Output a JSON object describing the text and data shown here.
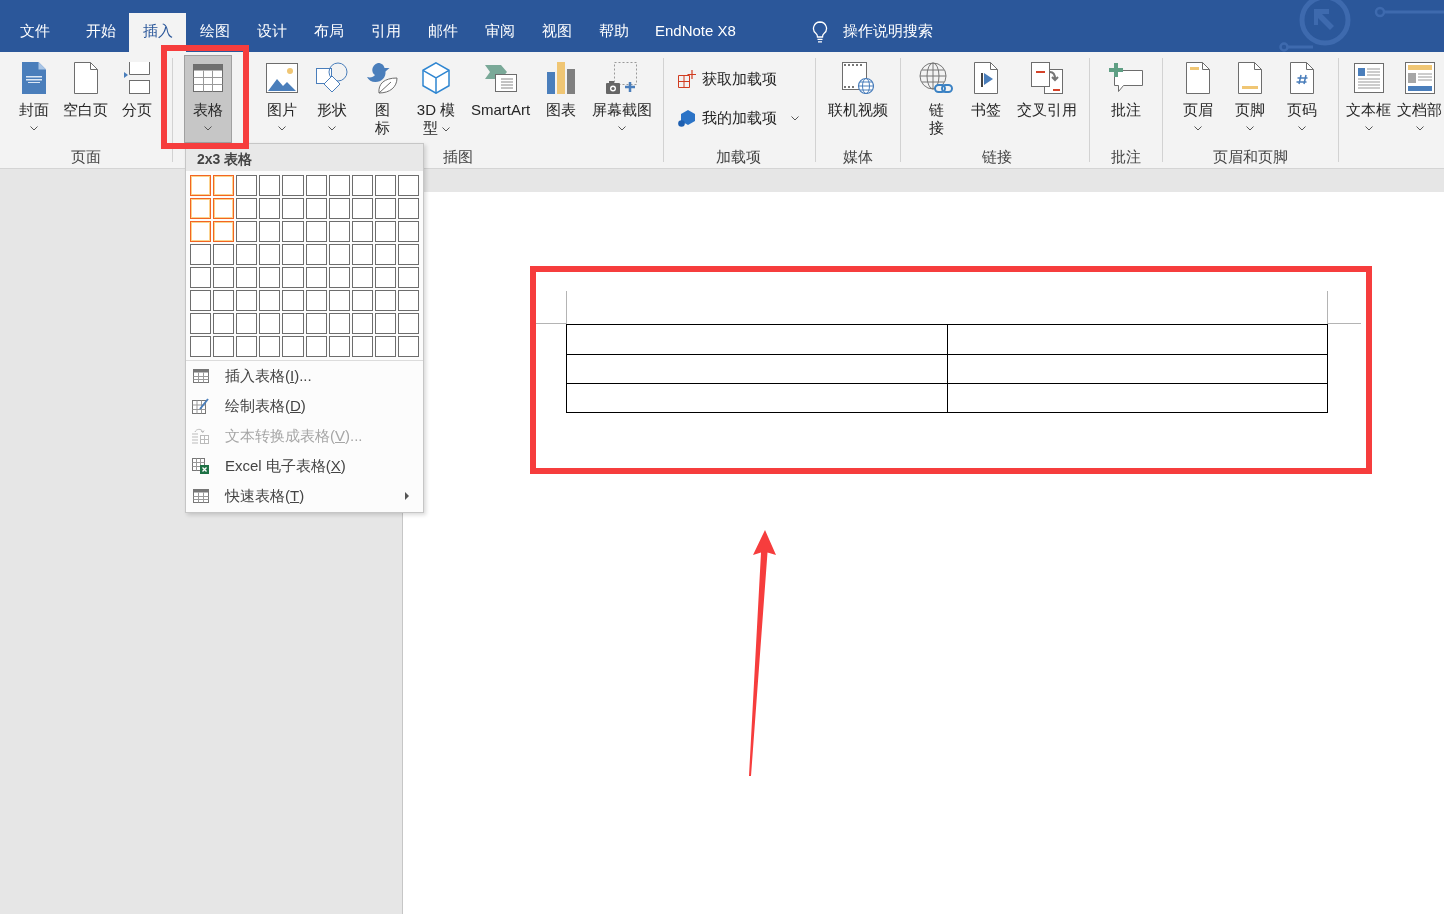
{
  "ribbon_tabs": [
    {
      "label": "文件",
      "selected": false
    },
    {
      "label": "开始",
      "selected": false
    },
    {
      "label": "插入",
      "selected": true
    },
    {
      "label": "绘图",
      "selected": false
    },
    {
      "label": "设计",
      "selected": false
    },
    {
      "label": "布局",
      "selected": false
    },
    {
      "label": "引用",
      "selected": false
    },
    {
      "label": "邮件",
      "selected": false
    },
    {
      "label": "审阅",
      "selected": false
    },
    {
      "label": "视图",
      "selected": false
    },
    {
      "label": "帮助",
      "selected": false
    },
    {
      "label": "EndNote X8",
      "selected": false
    }
  ],
  "tell_me": {
    "placeholder": "操作说明搜索"
  },
  "ribbon_groups": [
    {
      "label": "页面",
      "kind": "large",
      "commands": [
        {
          "label": "封面",
          "dropdown": true,
          "open": false
        },
        {
          "label": "空白页",
          "dropdown": false,
          "open": false
        },
        {
          "label": "分页",
          "dropdown": false,
          "open": false
        }
      ]
    },
    {
      "kind": "large",
      "commands": [
        {
          "label": "表格",
          "dropdown": true,
          "open": true
        }
      ]
    },
    {
      "label": "插图",
      "kind": "large",
      "commands": [
        {
          "label": "图片",
          "dropdown": true,
          "open": false
        },
        {
          "label": "形状",
          "dropdown": true,
          "open": false
        },
        {
          "label": "图标",
          "dropdown": false,
          "open": false
        },
        {
          "label": "3D 模型",
          "dropdown": true,
          "open": false
        },
        {
          "label": "SmartArt",
          "dropdown": false,
          "open": false
        },
        {
          "label": "图表",
          "dropdown": false,
          "open": false
        },
        {
          "label": "屏幕截图",
          "dropdown": true,
          "open": false
        }
      ]
    },
    {
      "label": "加载项",
      "kind": "small",
      "commands": [
        {
          "label": "获取加载项",
          "dropdown": false,
          "open": false
        },
        {
          "label": "我的加载项",
          "dropdown": true,
          "open": false
        }
      ]
    },
    {
      "label": "媒体",
      "kind": "large",
      "commands": [
        {
          "label": "联机视频",
          "dropdown": false,
          "open": false
        }
      ]
    },
    {
      "label": "链接",
      "kind": "large",
      "commands": [
        {
          "label": "链接",
          "dropdown": false,
          "open": false
        },
        {
          "label": "书签",
          "dropdown": false,
          "open": false
        },
        {
          "label": "交叉引用",
          "dropdown": false,
          "open": false
        }
      ]
    },
    {
      "label": "批注",
      "kind": "large",
      "commands": [
        {
          "label": "批注",
          "dropdown": false,
          "open": false
        }
      ]
    },
    {
      "label": "页眉和页脚",
      "kind": "large",
      "commands": [
        {
          "label": "页眉",
          "dropdown": true,
          "open": false
        },
        {
          "label": "页脚",
          "dropdown": true,
          "open": false
        },
        {
          "label": "页码",
          "dropdown": true,
          "open": false
        }
      ]
    },
    {
      "kind": "large",
      "commands": [
        {
          "label": "文本框",
          "dropdown": true,
          "open": false
        },
        {
          "label": "文档部",
          "dropdown": true,
          "open": false
        }
      ]
    }
  ],
  "table_menu": {
    "title": "2x3 表格",
    "grid": [
      {
        "cells": [
          {
            "selected": true
          },
          {
            "selected": true
          },
          {
            "selected": false
          },
          {
            "selected": false
          },
          {
            "selected": false
          },
          {
            "selected": false
          },
          {
            "selected": false
          },
          {
            "selected": false
          },
          {
            "selected": false
          },
          {
            "selected": false
          }
        ]
      },
      {
        "cells": [
          {
            "selected": true
          },
          {
            "selected": true
          },
          {
            "selected": false
          },
          {
            "selected": false
          },
          {
            "selected": false
          },
          {
            "selected": false
          },
          {
            "selected": false
          },
          {
            "selected": false
          },
          {
            "selected": false
          },
          {
            "selected": false
          }
        ]
      },
      {
        "cells": [
          {
            "selected": true
          },
          {
            "selected": true
          },
          {
            "selected": false
          },
          {
            "selected": false
          },
          {
            "selected": false
          },
          {
            "selected": false
          },
          {
            "selected": false
          },
          {
            "selected": false
          },
          {
            "selected": false
          },
          {
            "selected": false
          }
        ]
      },
      {
        "cells": [
          {
            "selected": false
          },
          {
            "selected": false
          },
          {
            "selected": false
          },
          {
            "selected": false
          },
          {
            "selected": false
          },
          {
            "selected": false
          },
          {
            "selected": false
          },
          {
            "selected": false
          },
          {
            "selected": false
          },
          {
            "selected": false
          }
        ]
      },
      {
        "cells": [
          {
            "selected": false
          },
          {
            "selected": false
          },
          {
            "selected": false
          },
          {
            "selected": false
          },
          {
            "selected": false
          },
          {
            "selected": false
          },
          {
            "selected": false
          },
          {
            "selected": false
          },
          {
            "selected": false
          },
          {
            "selected": false
          }
        ]
      },
      {
        "cells": [
          {
            "selected": false
          },
          {
            "selected": false
          },
          {
            "selected": false
          },
          {
            "selected": false
          },
          {
            "selected": false
          },
          {
            "selected": false
          },
          {
            "selected": false
          },
          {
            "selected": false
          },
          {
            "selected": false
          },
          {
            "selected": false
          }
        ]
      },
      {
        "cells": [
          {
            "selected": false
          },
          {
            "selected": false
          },
          {
            "selected": false
          },
          {
            "selected": false
          },
          {
            "selected": false
          },
          {
            "selected": false
          },
          {
            "selected": false
          },
          {
            "selected": false
          },
          {
            "selected": false
          },
          {
            "selected": false
          }
        ]
      },
      {
        "cells": [
          {
            "selected": false
          },
          {
            "selected": false
          },
          {
            "selected": false
          },
          {
            "selected": false
          },
          {
            "selected": false
          },
          {
            "selected": false
          },
          {
            "selected": false
          },
          {
            "selected": false
          },
          {
            "selected": false
          },
          {
            "selected": false
          }
        ]
      }
    ],
    "items": [
      {
        "text_before": "插入表格(",
        "access_key": "I",
        "text_after": ")...",
        "disabled": false,
        "submenu": false
      },
      {
        "text_before": "绘制表格(",
        "access_key": "D",
        "text_after": ")",
        "disabled": false,
        "submenu": false
      },
      {
        "text_before": "文本转换成表格(",
        "access_key": "V",
        "text_after": ")...",
        "disabled": true,
        "submenu": false
      },
      {
        "text_before": "Excel 电子表格(",
        "access_key": "X",
        "text_after": ")",
        "disabled": false,
        "submenu": false
      },
      {
        "text_before": "快速表格(",
        "access_key": "T",
        "text_after": ")",
        "disabled": false,
        "submenu": true
      }
    ]
  }
}
